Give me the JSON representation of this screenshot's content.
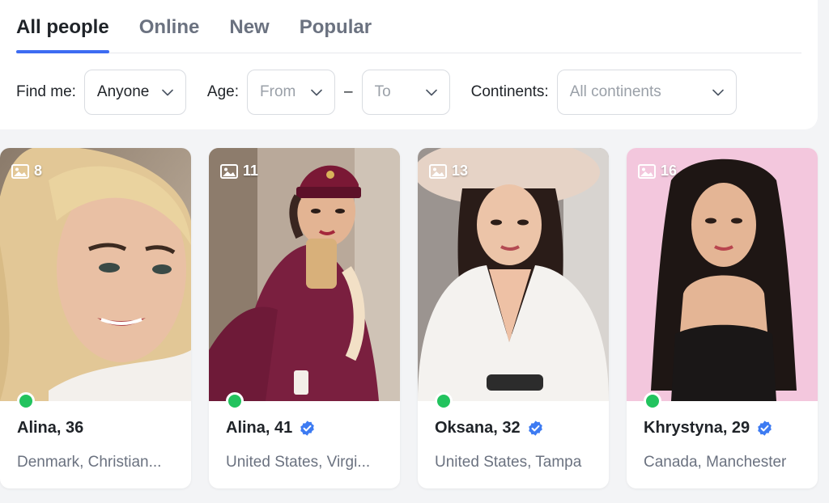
{
  "tabs": [
    {
      "label": "All people",
      "active": true
    },
    {
      "label": "Online",
      "active": false
    },
    {
      "label": "New",
      "active": false
    },
    {
      "label": "Popular",
      "active": false
    }
  ],
  "filters": {
    "find_me_label": "Find me:",
    "find_me_value": "Anyone",
    "age_label": "Age:",
    "age_from_placeholder": "From",
    "age_separator": "–",
    "age_to_placeholder": "To",
    "continents_label": "Continents:",
    "continents_placeholder": "All continents"
  },
  "profiles": [
    {
      "name": "Alina, 36",
      "location": "Denmark, Christian...",
      "photo_count": "8",
      "online": true,
      "verified": false
    },
    {
      "name": "Alina, 41",
      "location": "United States, Virgi...",
      "photo_count": "11",
      "online": true,
      "verified": true
    },
    {
      "name": "Oksana, 32",
      "location": "United States, Tampa",
      "photo_count": "13",
      "online": true,
      "verified": true
    },
    {
      "name": "Khrystyna, 29",
      "location": "Canada, Manchester",
      "photo_count": "16",
      "online": true,
      "verified": true
    }
  ],
  "colors": {
    "accent": "#3d6cf2",
    "online": "#22c35e",
    "verified": "#3d7bf2"
  },
  "icons": {
    "photo_count": "image-icon",
    "verified": "verified-badge-icon",
    "dropdown": "chevron-down-icon"
  }
}
